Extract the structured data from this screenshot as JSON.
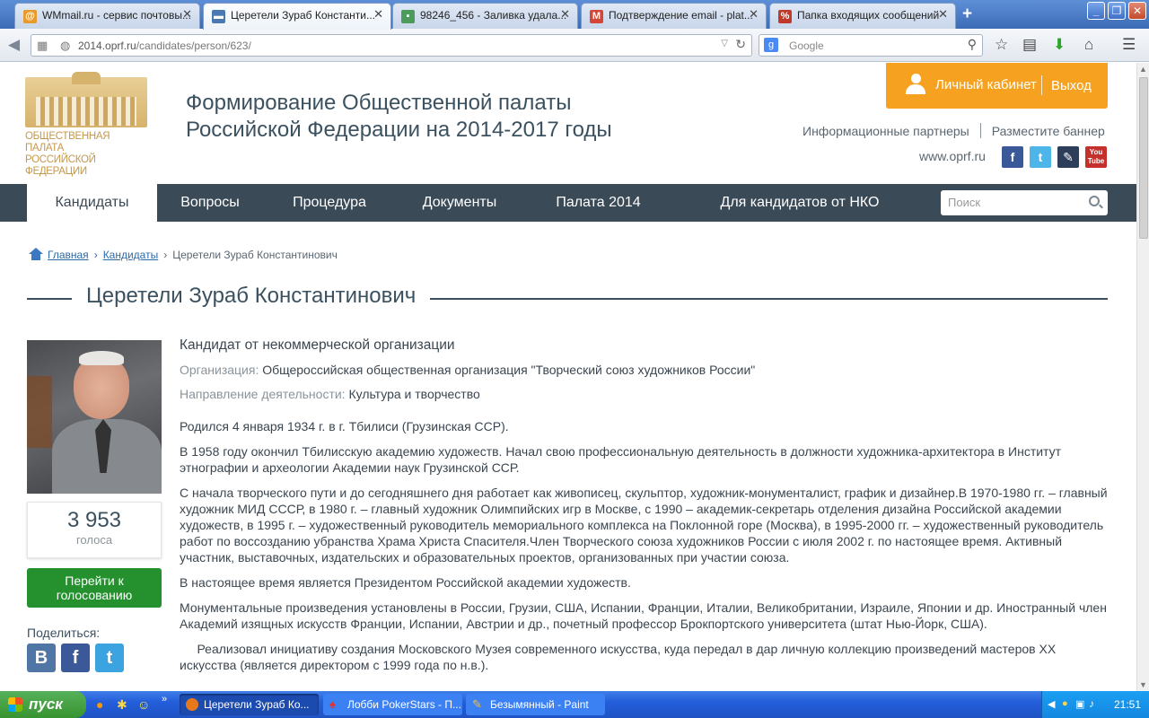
{
  "browser": {
    "tabs": [
      {
        "title": "WMmail.ru - сервис почтовы...",
        "icon_color": "#e89a2c",
        "icon_glyph": "@"
      },
      {
        "title": "Церетели Зураб Константи...",
        "icon_color": "#4a78b0",
        "icon_glyph": "▬"
      },
      {
        "title": "98246_456 - Заливка удала...",
        "icon_color": "#4c9b5a",
        "icon_glyph": "▪"
      },
      {
        "title": "Подтверждение email - plat...",
        "icon_color": "#d44638",
        "icon_glyph": "M"
      },
      {
        "title": "Папка входящих сообщений",
        "icon_color": "#c0392b",
        "icon_glyph": "%"
      }
    ],
    "url_host": "2014.oprf.ru",
    "url_path": "/candidates/person/623/",
    "search_placeholder": "Google"
  },
  "header": {
    "logo_text": [
      "Общественная палата",
      "Российской Федерации"
    ],
    "site_title": [
      "Формирование Общественной палаты",
      "Российской Федерации на 2014-2017 годы"
    ],
    "cabinet_label": "Личный кабинет",
    "logout_label": "Выход",
    "partners_label": "Информационные партнеры",
    "banner_label": "Разместите баннер",
    "site_link": "www.oprf.ru"
  },
  "nav": {
    "items": [
      "Кандидаты",
      "Вопросы",
      "Процедура",
      "Документы",
      "Палата 2014",
      "Для кандидатов от НКО"
    ],
    "search_placeholder": "Поиск"
  },
  "breadcrumb": {
    "home": "Главная",
    "candidates": "Кандидаты",
    "current": "Церетели Зураб Константинович"
  },
  "person": {
    "name": "Церетели Зураб Константинович",
    "votes": "3 953",
    "votes_label": "голоса",
    "vote_button": "Перейти к голосованию",
    "share_label": "Поделиться:",
    "candidate_type": "Кандидат от некоммерческой организации",
    "org_key": "Организация:",
    "org_value": "Общероссийская общественная организация \"Творческий союз художников России\"",
    "dir_key": "Направление деятельности:",
    "dir_value": "Культура и творчество",
    "bio": [
      "Родился 4 января 1934 г. в г. Тбилиси (Грузинская ССР).",
      "В 1958 году окончил Тбилисскую академию художеств.     Начал свою профессиональную деятельность  в должности художника-архитектора  в Институт этнографии и археологии Академии наук Грузинской ССР.",
      "С начала творческого пути и до сегодняшнего дня работает как живописец, скульптор, художник-монументалист, график и дизайнер.В 1970-1980 гг. – главный художник МИД СССР, в 1980 г. – главный художник Олимпийских игр в Москве, с 1990 – академик-секретарь отделения дизайна Российской академии художеств, в 1995 г. – художественный руководитель мемориального комплекса на Поклонной горе (Москва), в 1995-2000 гг. – художественный руководитель работ по воссозданию убранства Храма Христа Спасителя.Член Творческого союза художников России с июля 2002 г. по настоящее время. Активный участник, выставочных, издательских и образовательных проектов, организованных при участии союза.",
      "В настоящее время является Президентом Российской академии художеств.",
      "Монументальные произведения установлены в России, Грузии, США, Испании, Франции, Италии, Великобритании, Израиле, Японии и др. Иностранный член Академий изящных искусств Франции, Испании, Австрии и др.,  почетный профессор Брокпортского университета (штат Нью-Йорк, США).",
      "     Реализовал инициативу создания Московского Музея современного искусства, куда передал в дар личную коллекцию произведений мастеров XX искусства (является директором с 1999 года по н.в.)."
    ]
  },
  "taskbar": {
    "start_label": "пуск",
    "windows": [
      "Церетели Зураб Ко...",
      "Лобби PokerStars - П...",
      "Безымянный - Paint"
    ],
    "clock": "21:51"
  }
}
